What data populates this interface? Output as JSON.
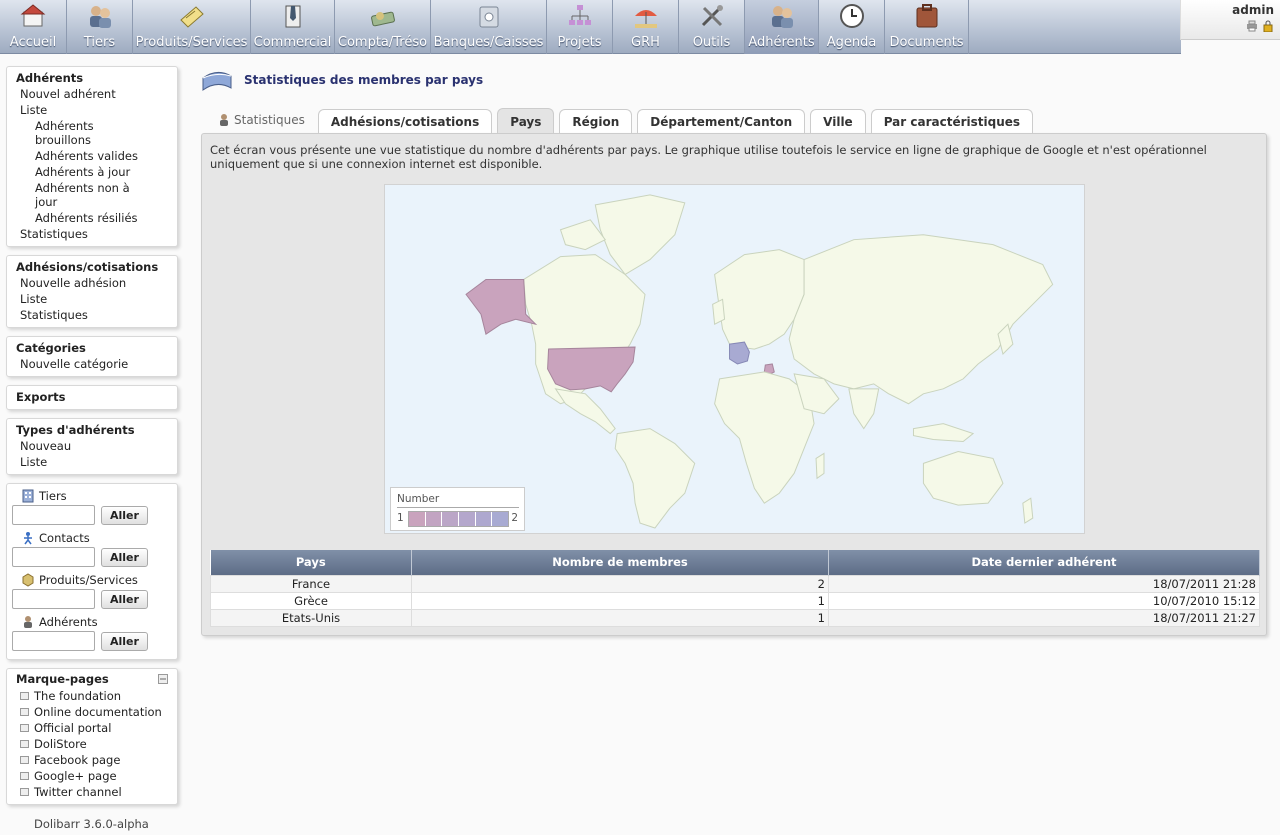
{
  "topmenu": [
    {
      "label": "Accueil",
      "icon": "home-icon",
      "active": false
    },
    {
      "label": "Tiers",
      "icon": "thirdparty-icon",
      "active": false
    },
    {
      "label": "Produits/Services",
      "icon": "product-icon",
      "active": false
    },
    {
      "label": "Commercial",
      "icon": "commercial-icon",
      "active": false
    },
    {
      "label": "Compta/Tréso",
      "icon": "money-icon",
      "active": false
    },
    {
      "label": "Banques/Caisses",
      "icon": "bank-icon",
      "active": false
    },
    {
      "label": "Projets",
      "icon": "project-icon",
      "active": false
    },
    {
      "label": "GRH",
      "icon": "holiday-icon",
      "active": false
    },
    {
      "label": "Outils",
      "icon": "tools-icon",
      "active": false
    },
    {
      "label": "Adhérents",
      "icon": "members-icon",
      "active": true
    },
    {
      "label": "Agenda",
      "icon": "clock-icon",
      "active": false
    },
    {
      "label": "Documents",
      "icon": "documents-icon",
      "active": false
    }
  ],
  "user": {
    "login": "admin"
  },
  "leftmenu": {
    "members": {
      "title": "Adhérents",
      "new": "Nouvel adhérent",
      "list": "Liste",
      "drafts": "Adhérents brouillons",
      "valid": "Adhérents valides",
      "uptodate": "Adhérents à jour",
      "notuptodate": "Adhérents non à jour",
      "resiliated": "Adhérents résiliés",
      "stats": "Statistiques"
    },
    "subscriptions": {
      "title": "Adhésions/cotisations",
      "new": "Nouvelle adhésion",
      "list": "Liste",
      "stats": "Statistiques"
    },
    "categories": {
      "title": "Catégories",
      "new": "Nouvelle catégorie"
    },
    "exports": {
      "title": "Exports"
    },
    "types": {
      "title": "Types d'adhérents",
      "new": "Nouveau",
      "list": "Liste"
    }
  },
  "search": {
    "button": "Aller",
    "thirdparties": "Tiers",
    "contacts": "Contacts",
    "products": "Produits/Services",
    "members": "Adhérents"
  },
  "bookmarks": {
    "title": "Marque-pages",
    "items": [
      "The foundation",
      "Online documentation",
      "Official portal",
      "DoliStore",
      "Facebook page",
      "Google+ page",
      "Twitter channel"
    ]
  },
  "version": "Dolibarr 3.6.0-alpha",
  "page": {
    "title": "Statistiques des membres par pays",
    "tabs": {
      "stats": "Statistiques",
      "subscriptions": "Adhésions/cotisations",
      "country": "Pays",
      "region": "Région",
      "department": "Département/Canton",
      "town": "Ville",
      "characteristics": "Par caractéristiques"
    },
    "active_tab": "country",
    "intro": "Cet écran vous présente une vue statistique du nombre d'adhérents par pays. Le graphique utilise toutefois le service en ligne de graphique de Google et n'est opérationnel uniquement que si une connexion internet est disponible."
  },
  "map": {
    "legend_title": "Number",
    "legend_min": "1",
    "legend_max": "2",
    "colors": {
      "ocean": "#eaf3fb",
      "land": "#f5f9e8",
      "border": "#c9d3bd",
      "min": "#c9a3bd",
      "max": "#a8aad2"
    },
    "highlighted": [
      {
        "country": "Etats-Unis",
        "value": 1
      },
      {
        "country": "France",
        "value": 2
      },
      {
        "country": "Grèce",
        "value": 1
      }
    ]
  },
  "table": {
    "headers": [
      "Pays",
      "Nombre de membres",
      "Date dernier adhérent"
    ],
    "rows": [
      [
        "France",
        "2",
        "18/07/2011 21:28"
      ],
      [
        "Grèce",
        "1",
        "10/07/2010 15:12"
      ],
      [
        "Etats-Unis",
        "1",
        "18/07/2011 21:27"
      ]
    ]
  }
}
